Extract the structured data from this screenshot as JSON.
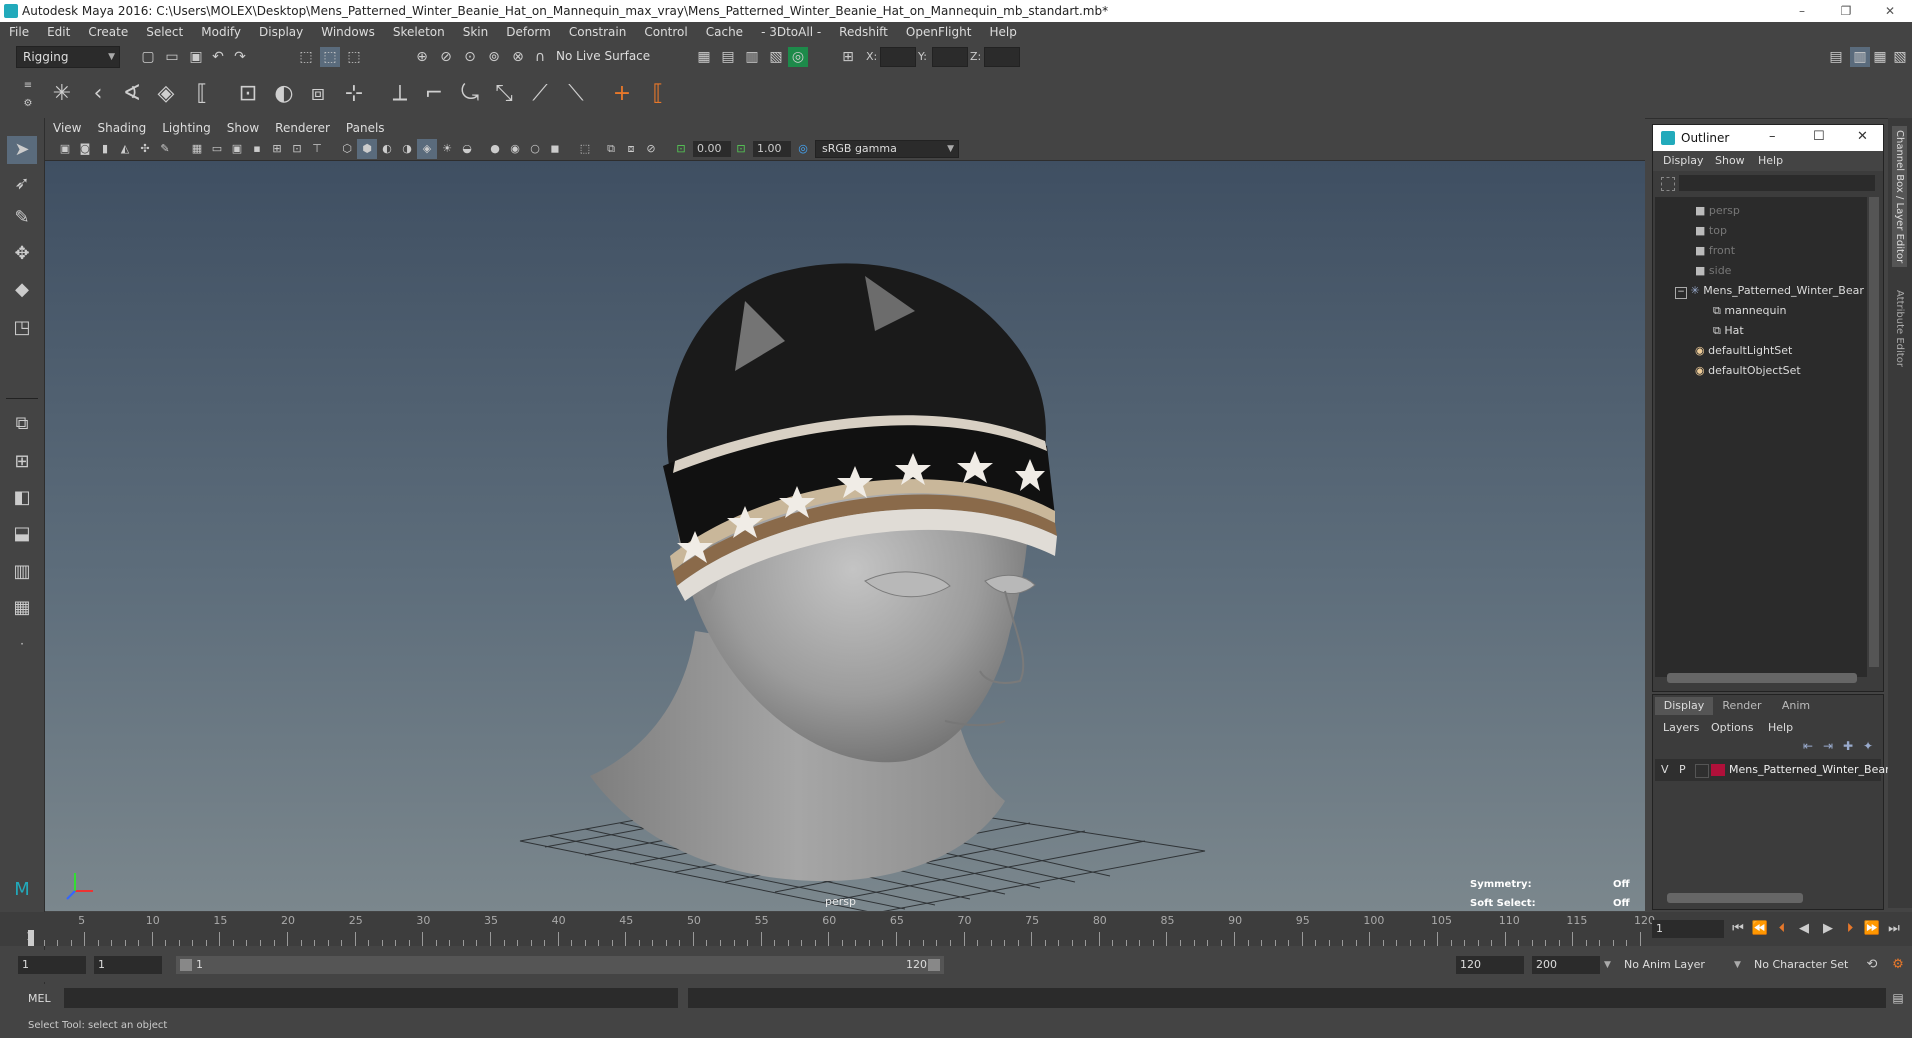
{
  "window": {
    "title": "Autodesk Maya 2016: C:\\Users\\MOLEX\\Desktop\\Mens_Patterned_Winter_Beanie_Hat_on_Mannequin_max_vray\\Mens_Patterned_Winter_Beanie_Hat_on_Mannequin_mb_standart.mb*",
    "minimize": "–",
    "maximize": "❐",
    "close": "✕"
  },
  "menubar": [
    "File",
    "Edit",
    "Create",
    "Select",
    "Modify",
    "Display",
    "Windows",
    "Skeleton",
    "Skin",
    "Deform",
    "Constrain",
    "Control",
    "Cache",
    "- 3DtoAll -",
    "Redshift",
    "OpenFlight",
    "Help"
  ],
  "statusline": {
    "mode": "Rigging",
    "live_surface": "No Live Surface",
    "x_label": "X:",
    "y_label": "Y:",
    "z_label": "Z:"
  },
  "viewport": {
    "menu": [
      "View",
      "Shading",
      "Lighting",
      "Show",
      "Renderer",
      "Panels"
    ],
    "exposure": "0.00",
    "gamma": "1.00",
    "color_space": "sRGB gamma",
    "camera_label": "persp",
    "symmetry_label": "Symmetry:",
    "symmetry_value": "Off",
    "soft_select_label": "Soft Select:",
    "soft_select_value": "Off"
  },
  "outliner": {
    "title": "Outliner",
    "menu": [
      "Display",
      "Show",
      "Help"
    ],
    "items": [
      {
        "label": "persp",
        "icon": "camera-icon",
        "dim": true
      },
      {
        "label": "top",
        "icon": "camera-icon",
        "dim": true
      },
      {
        "label": "front",
        "icon": "camera-icon",
        "dim": true
      },
      {
        "label": "side",
        "icon": "camera-icon",
        "dim": true
      },
      {
        "label": "Mens_Patterned_Winter_Bear",
        "icon": "group-icon",
        "dim": false
      },
      {
        "label": "mannequin",
        "icon": "mesh-icon",
        "dim": false
      },
      {
        "label": "Hat",
        "icon": "mesh-icon",
        "dim": false
      },
      {
        "label": "defaultLightSet",
        "icon": "set-icon",
        "dim": false
      },
      {
        "label": "defaultObjectSet",
        "icon": "set-icon",
        "dim": false
      }
    ],
    "collapse_symbol": "−"
  },
  "layer_editor": {
    "tabs": [
      "Display",
      "Render",
      "Anim"
    ],
    "menu": [
      "Layers",
      "Options",
      "Help"
    ],
    "layer": {
      "v": "V",
      "p": "P",
      "name": "Mens_Patterned_Winter_Beani",
      "color": "#b0103a"
    }
  },
  "right_strip": {
    "channel_box": "Channel Box / Layer Editor",
    "attribute_editor": "Attribute Editor"
  },
  "timeline": {
    "labels": [
      "5",
      "10",
      "15",
      "20",
      "25",
      "30",
      "35",
      "40",
      "45",
      "50",
      "55",
      "60",
      "65",
      "70",
      "75",
      "80",
      "85",
      "90",
      "95",
      "100",
      "105",
      "110",
      "115",
      "120"
    ],
    "start_label": "1",
    "current_frame": "1"
  },
  "range": {
    "start": "1",
    "playback_start": "1",
    "slider_start": "1",
    "slider_end": "120",
    "playback_end": "120",
    "end": "200",
    "anim_layer": "No Anim Layer",
    "character_set": "No Character Set"
  },
  "cmdline": {
    "label": "MEL"
  },
  "helpline": {
    "text": "Select Tool: select an object"
  }
}
